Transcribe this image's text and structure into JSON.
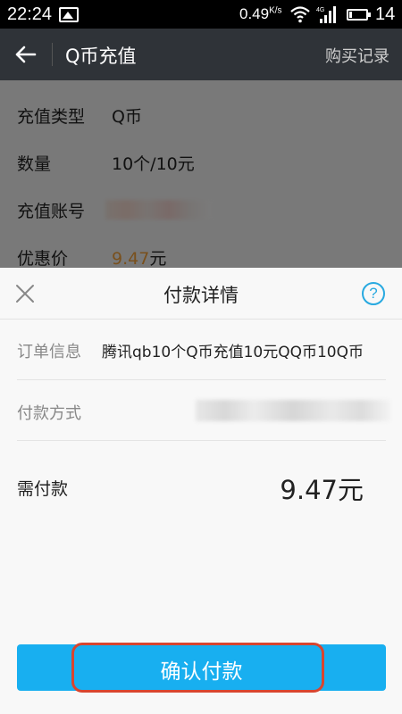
{
  "status_bar": {
    "time": "22:24",
    "speed": "0.49",
    "speed_unit": "K/s",
    "network": "4G",
    "battery": "14",
    "battery_fraction": 0.14,
    "icons": [
      "gallery-icon",
      "wifi-icon",
      "signal-icon",
      "battery-icon"
    ]
  },
  "app_bar": {
    "back_icon": "back-arrow-icon",
    "title": "Q币充值",
    "action": "购买记录"
  },
  "form": {
    "type_label": "充值类型",
    "type_value": "Q币",
    "quantity_label": "数量",
    "quantity_value": "10个/10元",
    "account_label": "充值账号",
    "discount_label": "优惠价",
    "discount_amount": "9.47",
    "discount_unit": "元"
  },
  "payment_sheet": {
    "close_icon": "close-icon",
    "title": "付款详情",
    "help_icon": "help-icon",
    "order_label": "订单信息",
    "order_value": "腾讯qb10个Q币充值10元QQ币10Q币",
    "method_label": "付款方式",
    "amount_label": "需付款",
    "amount_value": "9.47元",
    "confirm_label": "确认付款"
  },
  "colors": {
    "accent_blue": "#18aff0",
    "price_orange": "#f3a03a",
    "highlight_red": "#d8452f",
    "appbar_bg": "#2f3338"
  }
}
